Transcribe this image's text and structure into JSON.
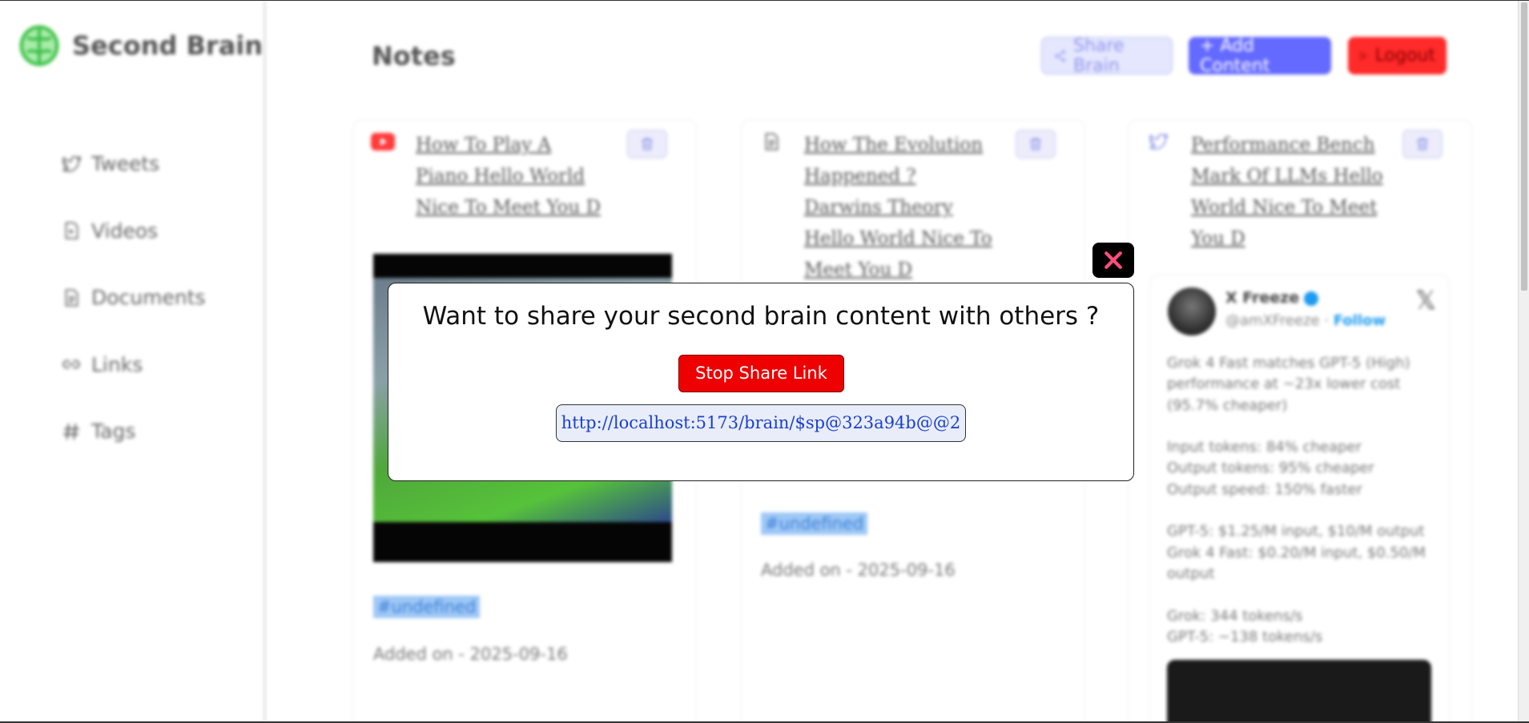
{
  "app": {
    "name": "Second Brain",
    "brand_color": "#5cd35c"
  },
  "sidebar": {
    "items": [
      {
        "label": "Tweets",
        "icon": "twitter-icon"
      },
      {
        "label": "Videos",
        "icon": "video-file-icon"
      },
      {
        "label": "Documents",
        "icon": "document-icon"
      },
      {
        "label": "Links",
        "icon": "link-icon"
      },
      {
        "label": "Tags",
        "icon": "hash-icon"
      }
    ]
  },
  "header": {
    "title": "Notes",
    "share_label": "Share Brain",
    "add_label": "+ Add Content",
    "logout_label": "Logout"
  },
  "cards": [
    {
      "type": "youtube",
      "title": "How To Play A Piano Hello World Nice To Meet You D",
      "tag": "#undefined",
      "added": "Added on - 2025-09-16"
    },
    {
      "type": "document",
      "title": "How The Evolution Happened ? Darwins Theory Hello World Nice To Meet You D",
      "tag": "#undefined",
      "added": "Added on - 2025-09-16"
    },
    {
      "type": "twitter",
      "title": "Performance Bench Mark Of LLMs Hello World Nice To Meet You D",
      "tweet": {
        "name": "X Freeze",
        "handle": "@amXFreeze",
        "separator": "·",
        "follow": "Follow",
        "text": "Grok 4 Fast matches GPT-5 (High) performance at ~23x lower cost (95.7% cheaper)\n\nInput tokens: 84% cheaper\nOutput tokens: 95% cheaper\nOutput speed: 150% faster\n\nGPT-5: $1.25/M input, $10/M output\nGrok 4 Fast: $0.20/M input, $0.50/M output\n\nGrok: 344 tokens/s\nGPT-5: ~138 tokens/s"
      }
    }
  ],
  "modal": {
    "title": "Want to share your second brain content with others ?",
    "stop_label": "Stop Share Link",
    "link": "http://localhost:5173/brain/$sp@323a94b@@2"
  },
  "colors": {
    "primary": "#6469ff",
    "danger": "#ee0000",
    "tag_bg": "#9ec8f6"
  }
}
